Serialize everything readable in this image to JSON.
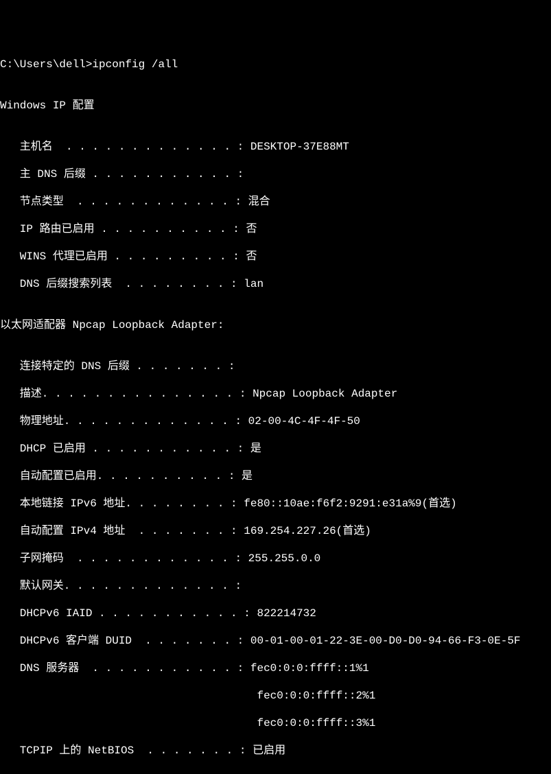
{
  "prompt": "C:\\Users\\dell>ipconfig /all",
  "blank": "",
  "header_ip_config": "Windows IP 配置",
  "host": {
    "hostname_label": "   主机名  . . . . . . . . . . . . . : ",
    "hostname_value": "DESKTOP-37E88MT",
    "primary_dns_label": "   主 DNS 后缀 . . . . . . . . . . . :",
    "node_type_label": "   节点类型  . . . . . . . . . . . . : ",
    "node_type_value": "混合",
    "ip_routing_label": "   IP 路由已启用 . . . . . . . . . . : ",
    "ip_routing_value": "否",
    "wins_proxy_label": "   WINS 代理已启用 . . . . . . . . . : ",
    "wins_proxy_value": "否",
    "dns_suffix_list_label": "   DNS 后缀搜索列表  . . . . . . . . : ",
    "dns_suffix_list_value": "lan"
  },
  "adapter_header": "以太网适配器 Npcap Loopback Adapter:",
  "adapter": {
    "conn_dns_label": "   连接特定的 DNS 后缀 . . . . . . . :",
    "desc_label": "   描述. . . . . . . . . . . . . . . : ",
    "desc_value": "Npcap Loopback Adapter",
    "phys_label": "   物理地址. . . . . . . . . . . . . : ",
    "phys_value": "02-00-4C-4F-4F-50",
    "dhcp_label": "   DHCP 已启用 . . . . . . . . . . . : ",
    "dhcp_value": "是",
    "autoconf_label": "   自动配置已启用. . . . . . . . . . : ",
    "autoconf_value": "是",
    "ipv6_label": "   本地链接 IPv6 地址. . . . . . . . : ",
    "ipv6_value": "fe80::10ae:f6f2:9291:e31a%9(首选)",
    "ipv4_label": "   自动配置 IPv4 地址  . . . . . . . : ",
    "ipv4_value": "169.254.227.26(首选)",
    "subnet_label": "   子网掩码  . . . . . . . . . . . . : ",
    "subnet_value": "255.255.0.0",
    "gateway_label": "   默认网关. . . . . . . . . . . . . :",
    "iaid_label": "   DHCPv6 IAID . . . . . . . . . . . : ",
    "iaid_value": "822214732",
    "duid_label": "   DHCPv6 客户端 DUID  . . . . . . . : ",
    "duid_value": "00-01-00-01-22-3E-00-D0-D0-94-66-F3-0E-5F",
    "dns_label": "   DNS 服务器  . . . . . . . . . . . : ",
    "dns_value1": "fec0:0:0:ffff::1%1",
    "dns_indent": "                                       ",
    "dns_value2": "fec0:0:0:ffff::2%1",
    "dns_value3": "fec0:0:0:ffff::3%1",
    "netbios_label": "   TCPIP 上的 NetBIOS  . . . . . . . : ",
    "netbios_value": "已启用"
  }
}
